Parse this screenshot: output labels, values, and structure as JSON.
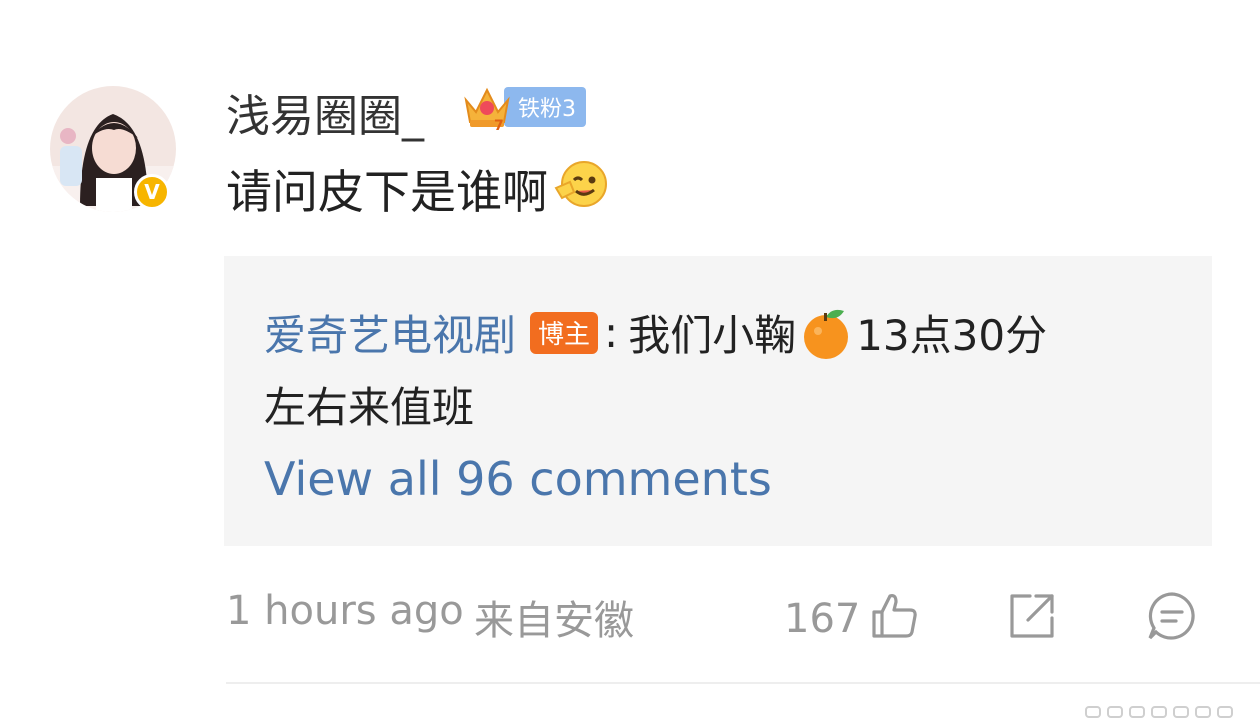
{
  "comment": {
    "username": "浅易圈圈_",
    "fan_badge": "铁粉3",
    "text": "请问皮下是谁啊",
    "avatar_verified": "V"
  },
  "reply": {
    "author": "爱奇艺电视剧",
    "author_tag": "博主",
    "separator": ":",
    "text_part1": "我们小鞠",
    "text_part2": "13点30分",
    "text_line2": "左右来值班",
    "view_all": "View all 96 comments"
  },
  "footer": {
    "timestamp": "1 hours ago",
    "location": "来自安徽",
    "like_count": "167"
  },
  "icons": [
    "like-icon",
    "share-icon",
    "comment-icon"
  ],
  "colors": {
    "link": "#4a76ac",
    "blogger_tag": "#f26d1f",
    "fan_badge": "#8db8ee",
    "verified": "#f7b500"
  }
}
